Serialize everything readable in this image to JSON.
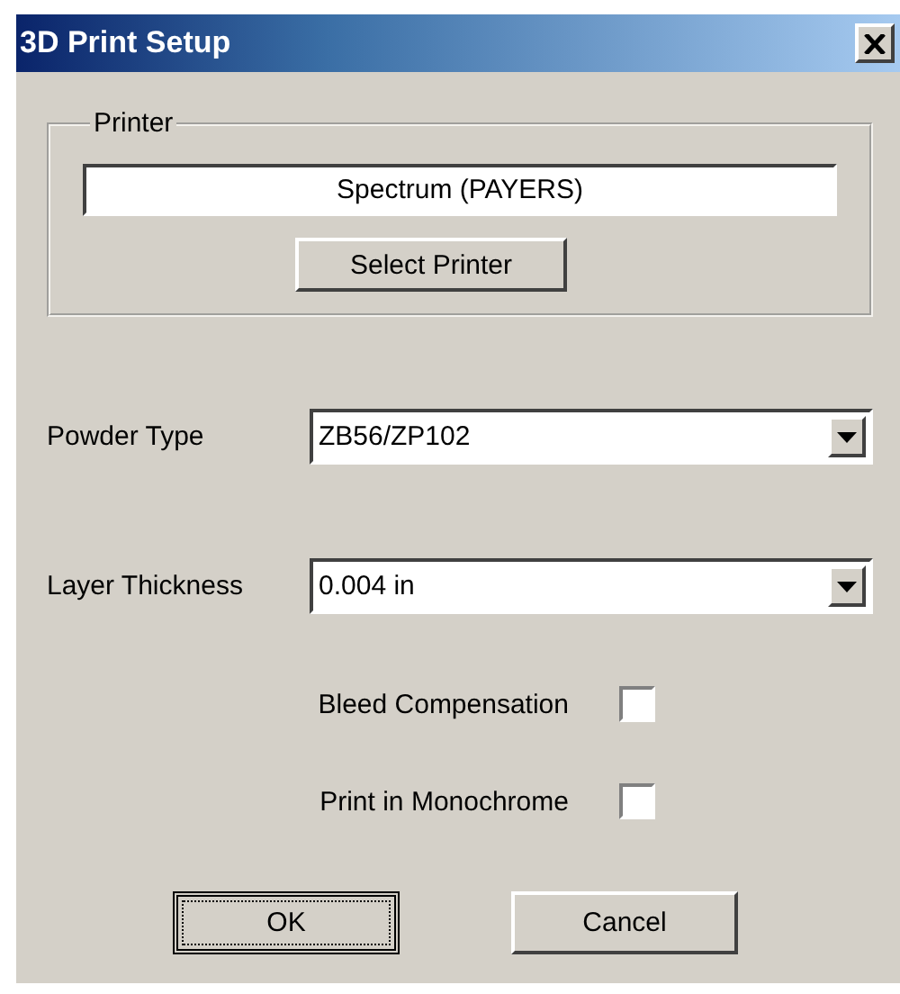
{
  "window": {
    "title": "3D Print Setup"
  },
  "printer_group": {
    "title": "Printer",
    "printer_name": "Spectrum (PAYERS)",
    "button": "Select Printer"
  },
  "fields": [
    {
      "label": "Powder Type",
      "value": "ZB56/ZP102"
    },
    {
      "label": "Layer Thickness",
      "value": "0.004 in"
    }
  ],
  "options": [
    {
      "label": "Bleed Compensation",
      "checked": false
    },
    {
      "label": "Print in Monochrome",
      "checked": false
    }
  ],
  "buttons": [
    {
      "label": "OK",
      "focused": true
    },
    {
      "label": "Cancel",
      "focused": false
    }
  ]
}
